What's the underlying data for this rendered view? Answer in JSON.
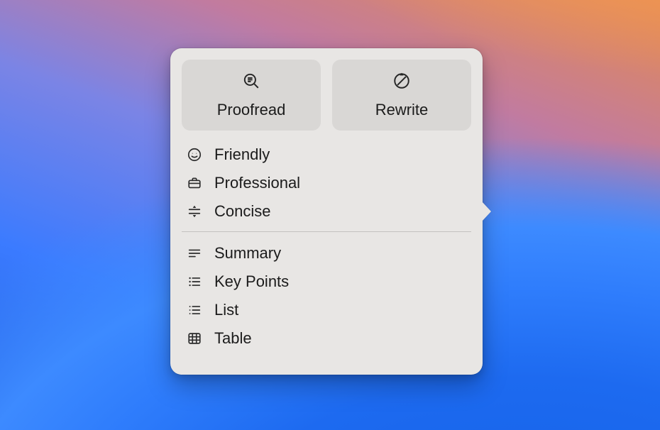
{
  "buttons": {
    "proofread": "Proofread",
    "rewrite": "Rewrite"
  },
  "tone_items": {
    "friendly": "Friendly",
    "professional": "Professional",
    "concise": "Concise"
  },
  "format_items": {
    "summary": "Summary",
    "key_points": "Key Points",
    "list": "List",
    "table": "Table"
  }
}
